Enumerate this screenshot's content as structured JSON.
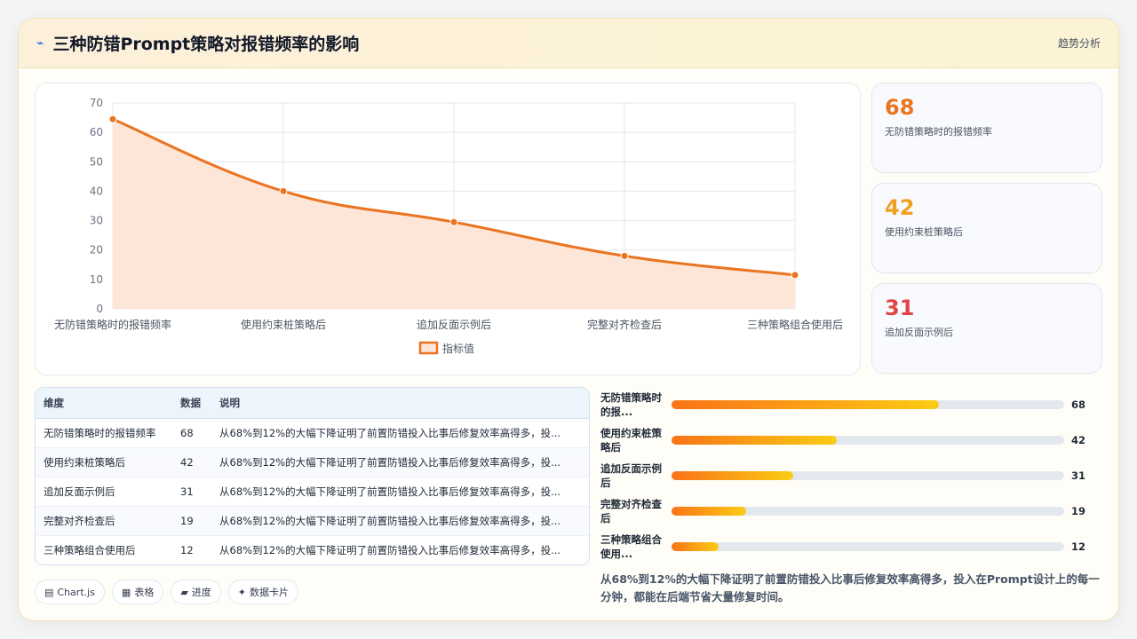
{
  "header": {
    "title": "三种防错Prompt策略对报错频率的影响",
    "right_label": "趋势分析",
    "icon": "sparkle-icon"
  },
  "chart_data": {
    "type": "line",
    "categories": [
      "无防错策略时的报错频率",
      "使用约束桩策略后",
      "追加反面示例后",
      "完整对齐检查后",
      "三种策略组合使用后"
    ],
    "series": [
      {
        "name": "指标值",
        "values": [
          64.5,
          40,
          29.5,
          18,
          11.5
        ],
        "color": "#ea7420",
        "fill": "#fde6d8"
      }
    ],
    "y_ticks": [
      0,
      10,
      20,
      30,
      40,
      50,
      60,
      70
    ],
    "ylim": [
      0,
      70
    ],
    "grid": true,
    "legend": "bottom",
    "title": "",
    "xlabel": "",
    "ylabel": ""
  },
  "stats": [
    {
      "value": "68",
      "label": "无防错策略时的报错频率",
      "color": "#ea7420"
    },
    {
      "value": "42",
      "label": "使用约束桩策略后",
      "color": "#f0a020"
    },
    {
      "value": "31",
      "label": "追加反面示例后",
      "color": "#e24545"
    }
  ],
  "table": {
    "headers": [
      "维度",
      "数据",
      "说明"
    ],
    "rows": [
      [
        "无防错策略时的报错频率",
        "68",
        "从68%到12%的大幅下降证明了前置防错投入比事后修复效率高得多，投..."
      ],
      [
        "使用约束桩策略后",
        "42",
        "从68%到12%的大幅下降证明了前置防错投入比事后修复效率高得多，投..."
      ],
      [
        "追加反面示例后",
        "31",
        "从68%到12%的大幅下降证明了前置防错投入比事后修复效率高得多，投..."
      ],
      [
        "完整对齐检查后",
        "19",
        "从68%到12%的大幅下降证明了前置防错投入比事后修复效率高得多，投..."
      ],
      [
        "三种策略组合使用后",
        "12",
        "从68%到12%的大幅下降证明了前置防错投入比事后修复效率高得多，投..."
      ]
    ]
  },
  "progress": [
    {
      "label": "无防错策略时的报...",
      "value": 68
    },
    {
      "label": "使用约束桩策略后",
      "value": 42
    },
    {
      "label": "追加反面示例后",
      "value": 31
    },
    {
      "label": "完整对齐检查后",
      "value": 19
    },
    {
      "label": "三种策略组合使用...",
      "value": 12
    }
  ],
  "progress_max": 100,
  "note": "从68%到12%的大幅下降证明了前置防错投入比事后修复效率高得多，投入在Prompt设计上的每一分钟，都能在后端节省大量修复时间。",
  "chips": [
    {
      "icon": "▤",
      "label": "Chart.js"
    },
    {
      "icon": "▦",
      "label": "表格"
    },
    {
      "icon": "▰",
      "label": "进度"
    },
    {
      "icon": "✦",
      "label": "数据卡片"
    }
  ]
}
